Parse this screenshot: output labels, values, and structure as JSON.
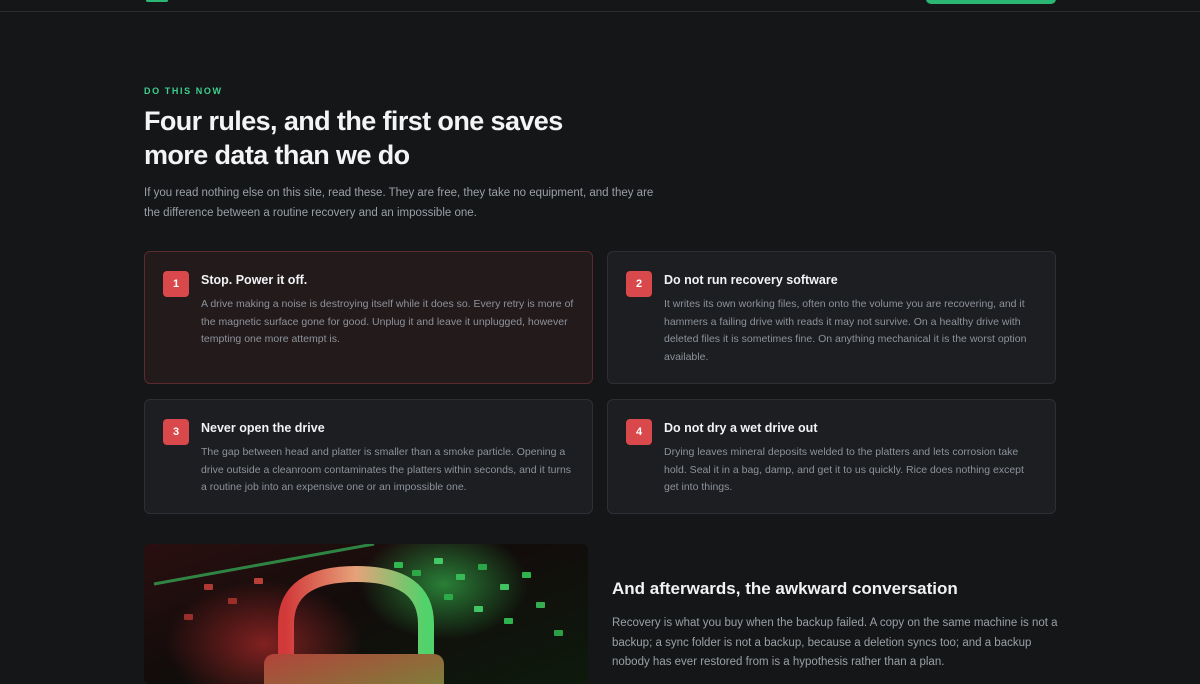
{
  "header": {
    "logo_icon": "logo-mark-icon",
    "cta_color": "#2bb673"
  },
  "intro": {
    "eyebrow": "DO THIS NOW",
    "title_line1": "Four rules, and the first one saves",
    "title_line2": "more data than we do",
    "lede": "If you read nothing else on this site, read these. They are free, they take no equipment, and they are the difference between a routine recovery and an impossible one."
  },
  "rules": [
    {
      "number": "1",
      "title": "Stop. Power it off.",
      "body": "A drive making a noise is destroying itself while it does so. Every retry is more of the magnetic surface gone for good. Unplug it and leave it unplugged, however tempting one more attempt is."
    },
    {
      "number": "2",
      "title": "Do not run recovery software",
      "body": "It writes its own working files, often onto the volume you are recovering, and it hammers a failing drive with reads it may not survive. On a healthy drive with deleted files it is sometimes fine. On anything mechanical it is the worst option available."
    },
    {
      "number": "3",
      "title": "Never open the drive",
      "body": "The gap between head and platter is smaller than a smoke particle. Opening a drive outside a cleanroom contaminates the platters within seconds, and it turns a routine job into an expensive one or an impossible one."
    },
    {
      "number": "4",
      "title": "Do not dry a wet drive out",
      "body": "Drying leaves mineral deposits welded to the platters and lets corrosion take hold. Seal it in a bag, damp, and get it to us quickly. Rice does nothing except get into things."
    }
  ],
  "aside": {
    "title": "And afterwards, the awkward conversation",
    "body": "Recovery is what you buy when the backup failed. A copy on the same machine is not a backup; a sync folder is not a backup, because a deletion syncs too; and a backup nobody has ever restored from is a hypothesis rather than a plan."
  },
  "colors": {
    "accent": "#3ecf8e",
    "badge": "#d9494b",
    "background": "#151618"
  }
}
